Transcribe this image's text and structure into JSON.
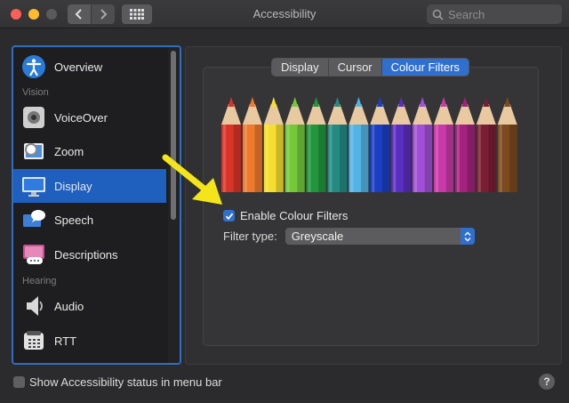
{
  "window": {
    "title": "Accessibility"
  },
  "toolbar": {
    "search_placeholder": "Search"
  },
  "sidebar": {
    "items": [
      {
        "label": "Overview"
      },
      {
        "label": "VoiceOver"
      },
      {
        "label": "Zoom"
      },
      {
        "label": "Display"
      },
      {
        "label": "Speech"
      },
      {
        "label": "Descriptions"
      },
      {
        "label": "Audio"
      },
      {
        "label": "RTT"
      }
    ],
    "sections": {
      "vision": "Vision",
      "hearing": "Hearing"
    }
  },
  "tabs": [
    {
      "label": "Display"
    },
    {
      "label": "Cursor"
    },
    {
      "label": "Colour Filters"
    }
  ],
  "colour_filters": {
    "enable_label": "Enable Colour Filters",
    "enabled": true,
    "filter_type_label": "Filter type:",
    "filter_type_value": "Greyscale",
    "pencil_colors": [
      "#d8352a",
      "#ee7a2c",
      "#f4df2f",
      "#74c93a",
      "#21963c",
      "#248b83",
      "#52b4e4",
      "#1a3fc5",
      "#5a2fc0",
      "#a04fd6",
      "#c93aa8",
      "#a4217e",
      "#7a1e34",
      "#7b4a1e"
    ]
  },
  "footer": {
    "status_label": "Show Accessibility status in menu bar",
    "help_label": "?"
  },
  "colors": {
    "accent": "#2f6fd0",
    "arrow": "#f4e51b"
  }
}
